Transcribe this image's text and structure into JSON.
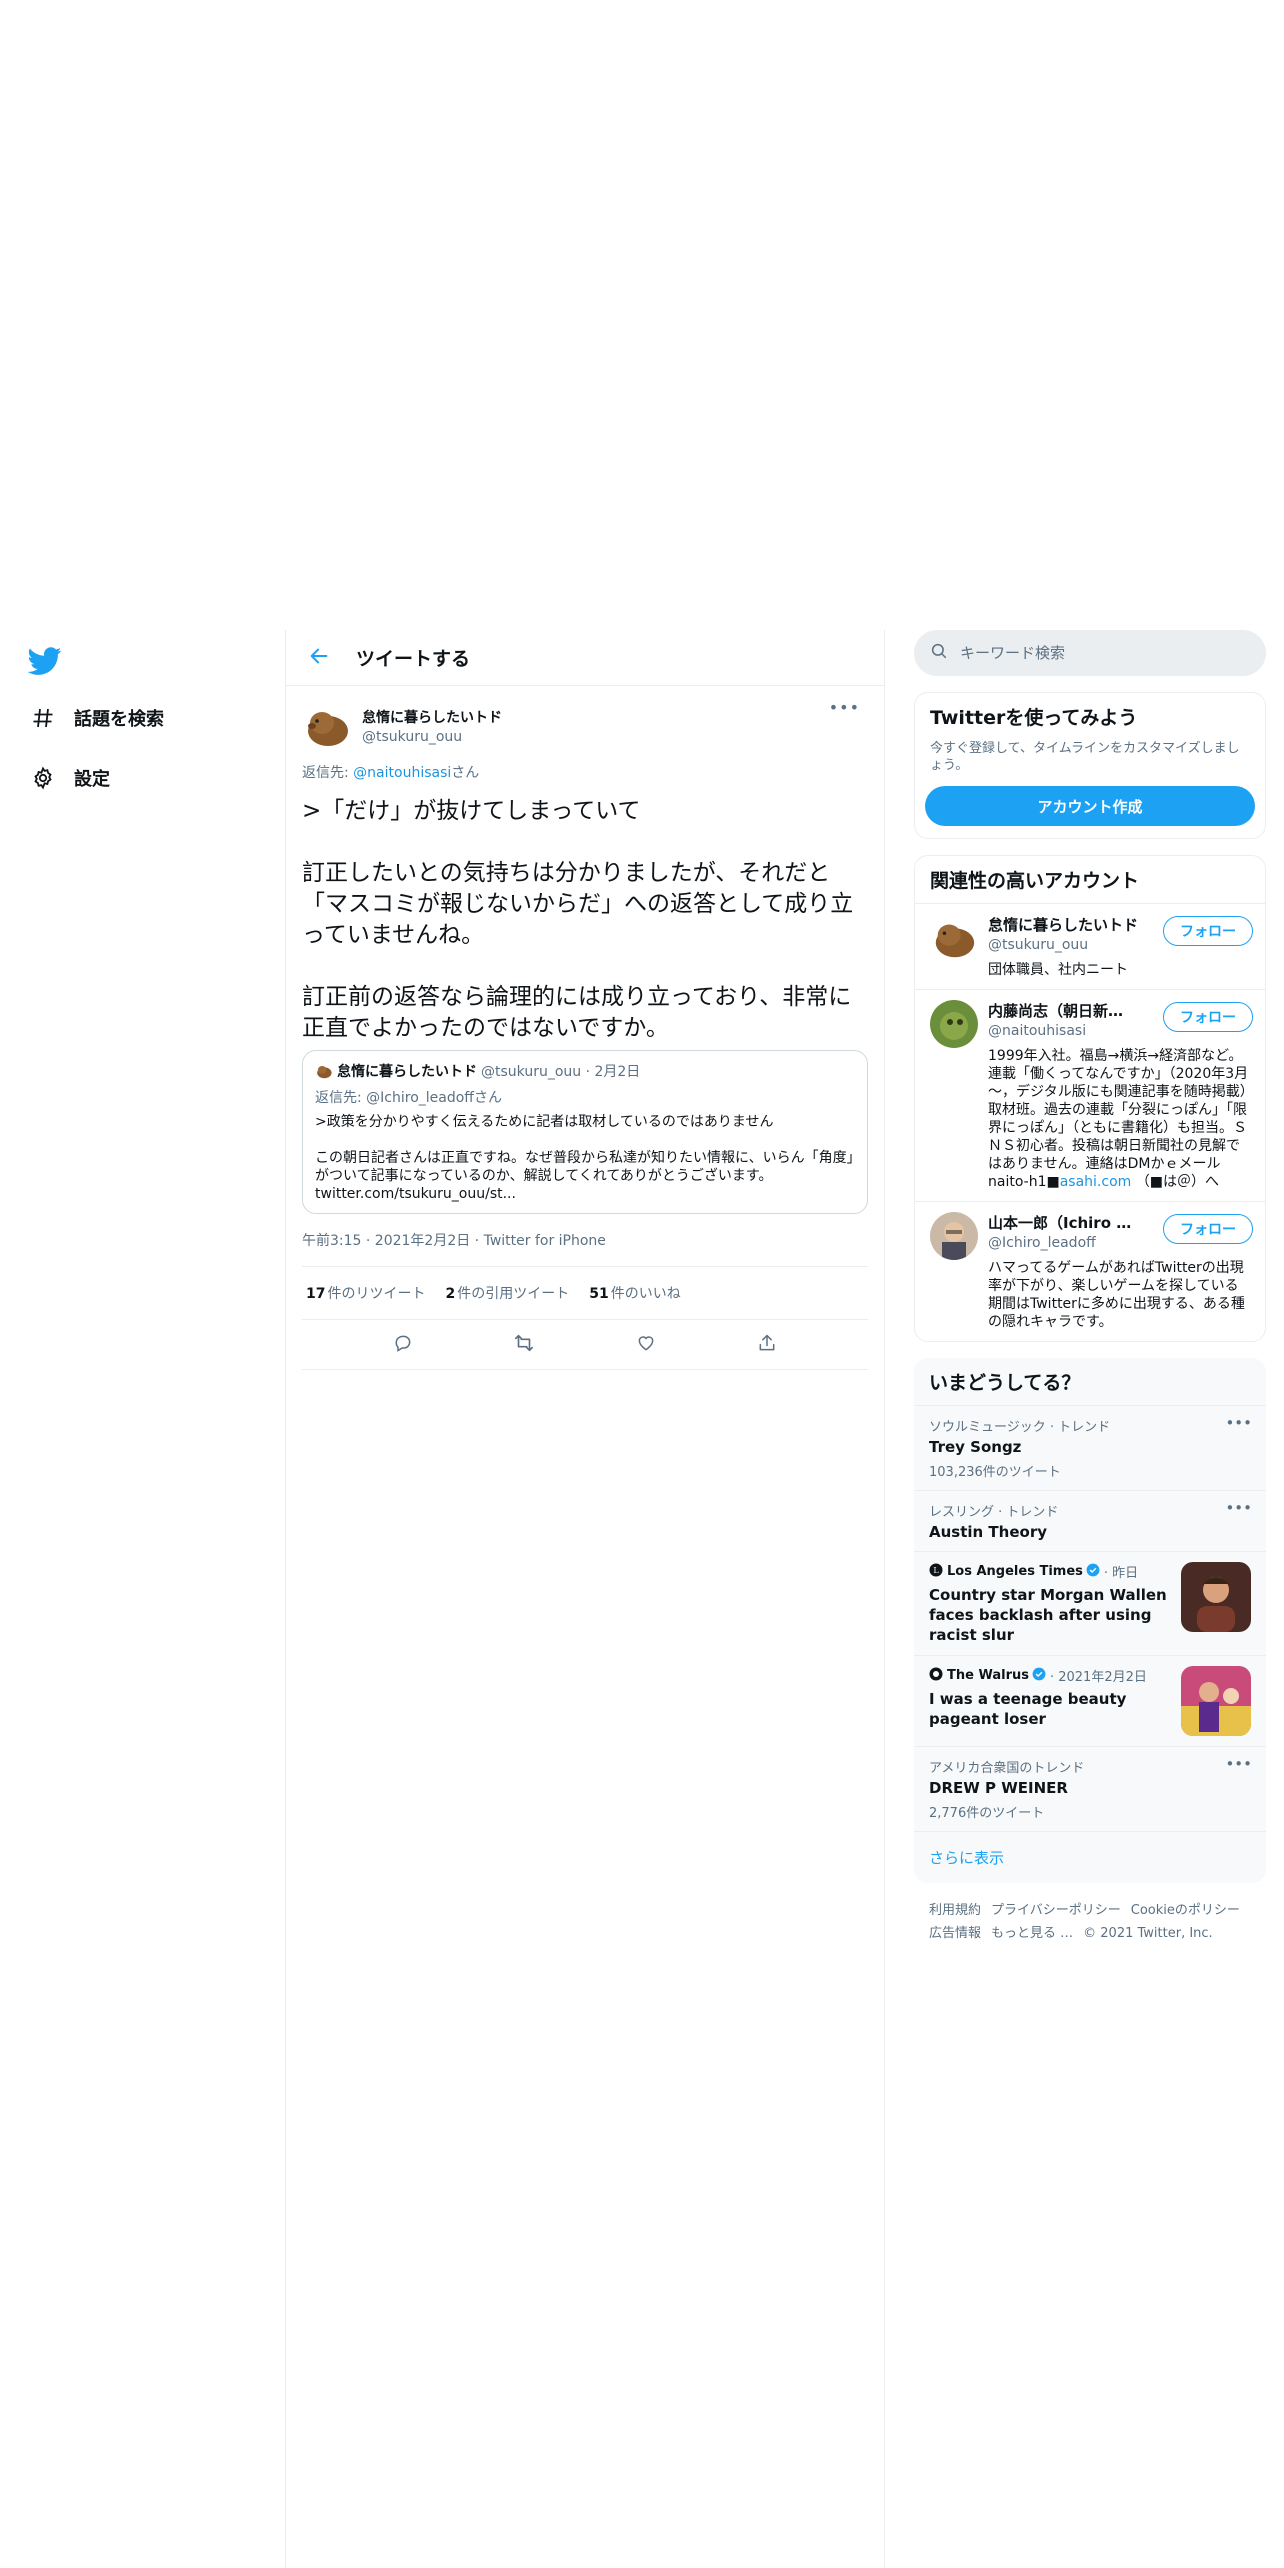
{
  "nav": {
    "items": [
      {
        "label": "話題を検索",
        "icon": "hashtag-icon"
      },
      {
        "label": "設定",
        "icon": "gear-icon"
      }
    ]
  },
  "header": {
    "title": "ツイートする"
  },
  "tweet": {
    "author_name": "怠惰に暮らしたいトド",
    "author_handle": "@tsukuru_ouu",
    "reply_prefix": "返信先: ",
    "reply_mention": "@naitouhisasi",
    "reply_suffix": "さん",
    "text": ">「だけ」が抜けてしまっていて\n\n訂正したいとの気持ちは分かりましたが、それだと「マスコミが報じないからだ」への返答として成り立っていませんね。\n\n訂正前の返答なら論理的には成り立っており、非常に正直でよかったのではないですか。",
    "quote": {
      "author_name": "怠惰に暮らしたいトド",
      "meta": "@tsukuru_ouu · 2月2日",
      "reply_to": "返信先: @Ichiro_leadoffさん",
      "text": ">政策を分かりやすく伝えるために記者は取材しているのではありません\n\nこの朝日記者さんは正直ですね。なぜ普段から私達が知りたい情報に、いらん「角度」がついて記事になっているのか、解説してくれてありがとうございます。 twitter.com/tsukuru_ouu/st..."
    },
    "timestamp": "午前3:15 · 2021年2月2日 · Twitter for iPhone",
    "stats": {
      "retweets_count": "17",
      "retweets_label": "件のリツイート",
      "quotes_count": "2",
      "quotes_label": "件の引用ツイート",
      "likes_count": "51",
      "likes_label": "件のいいね"
    }
  },
  "right": {
    "search_placeholder": "キーワード検索",
    "signup": {
      "title": "Twitterを使ってみよう",
      "desc": "今すぐ登録して、タイムラインをカスタマイズしましょう。",
      "button": "アカウント作成"
    },
    "relevant": {
      "title": "関連性の高いアカウント",
      "follow_label": "フォロー",
      "users": [
        {
          "name": "怠惰に暮らしたいトド",
          "handle": "@tsukuru_ouu",
          "bio": "団体職員、社内ニート",
          "bio_link": "",
          "bio_after": ""
        },
        {
          "name": "内藤尚志（朝日新聞経済部）",
          "handle": "@naitouhisasi",
          "bio": "1999年入社。福島→横浜→経済部など。連載「働くってなんですか」（2020年3月～，デジタル版にも関連記事を随時掲載）取材班。過去の連載「分裂にっぽん」「限界にっぽん」（ともに書籍化）も担当。ＳＮＳ初心者。投稿は朝日新聞社の見解ではありません。連絡はDMかｅメール naito-h1■",
          "bio_link": "asahi.com",
          "bio_after": " （■は＠）へ"
        },
        {
          "name": "山本一郎（Ichiro Yamamoto）",
          "handle": "@Ichiro_leadoff",
          "bio": "ハマってるゲームがあればTwitterの出現率が下がり、楽しいゲームを探している期間はTwitterに多めに出現する、ある種の隠れキャラです。",
          "bio_link": "",
          "bio_after": ""
        }
      ]
    },
    "trends": {
      "title": "いまどうしてる？",
      "items": [
        {
          "meta": "ソウルミュージック · トレンド",
          "name": "Trey Songz",
          "count": "103,236件のツイート"
        },
        {
          "meta": "レスリング · トレンド",
          "name": "Austin Theory",
          "count": ""
        }
      ],
      "news": [
        {
          "source": "Los Angeles Times",
          "time": "· 昨日",
          "title": "Country star Morgan Wallen faces backlash after using racist slur"
        },
        {
          "source": "The Walrus",
          "time": "· 2021年2月2日",
          "title": "I was a teenage beauty pageant loser"
        }
      ],
      "last": {
        "meta": "アメリカ合衆国のトレンド",
        "name": "DREW P WEINER",
        "count": "2,776件のツイート"
      },
      "show_more": "さらに表示"
    },
    "footer": {
      "links": [
        "利用規約",
        "プライバシーポリシー",
        "Cookieのポリシー",
        "広告情報",
        "もっと見る …",
        "© 2021 Twitter, Inc."
      ]
    }
  },
  "colors": {
    "accent": "#1da1f2",
    "text": "#0f1419",
    "secondary": "#5b7083",
    "border": "#ebeef0"
  }
}
